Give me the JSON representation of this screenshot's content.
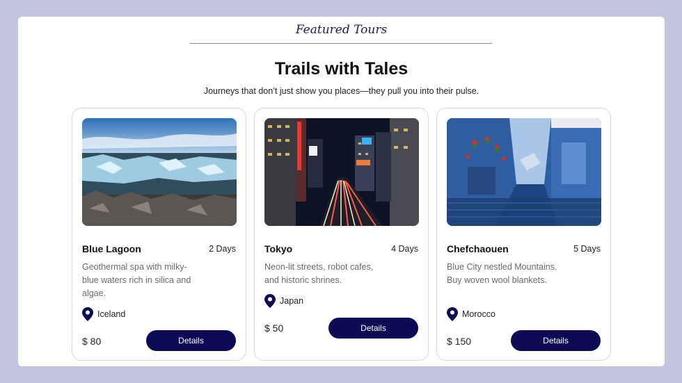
{
  "header": {
    "eyebrow": "Featured Tours",
    "title": "Trails with Tales",
    "subtitle": "Journeys that don’t just show you places—they pull you into their pulse."
  },
  "tours": [
    {
      "name": "Blue Lagoon",
      "duration": "2 Days",
      "description": "Geothermal spa with milky-blue waters rich in silica and algae.",
      "location": "Iceland",
      "price": "$ 80",
      "button_label": "Details",
      "image_alt": "Icebergs floating in a lagoon under a blue sky"
    },
    {
      "name": "Tokyo",
      "duration": "4 Days",
      "description": "Neon-lit streets, robot cafes, and historic shrines.",
      "location": "Japan",
      "price": "$ 50",
      "button_label": "Details",
      "image_alt": "Busy Tokyo street at night with neon signs"
    },
    {
      "name": "Chefchaouen",
      "duration": "5 Days",
      "description": "Blue City nestled Mountains. Buy woven wool blankets.",
      "location": "Morocco",
      "price": "$ 150",
      "button_label": "Details",
      "image_alt": "Blue painted alley with plant pots"
    }
  ],
  "colors": {
    "page_background": "#c4c4dc",
    "accent": "#0c0c55",
    "card_border": "#d6d6d6"
  }
}
